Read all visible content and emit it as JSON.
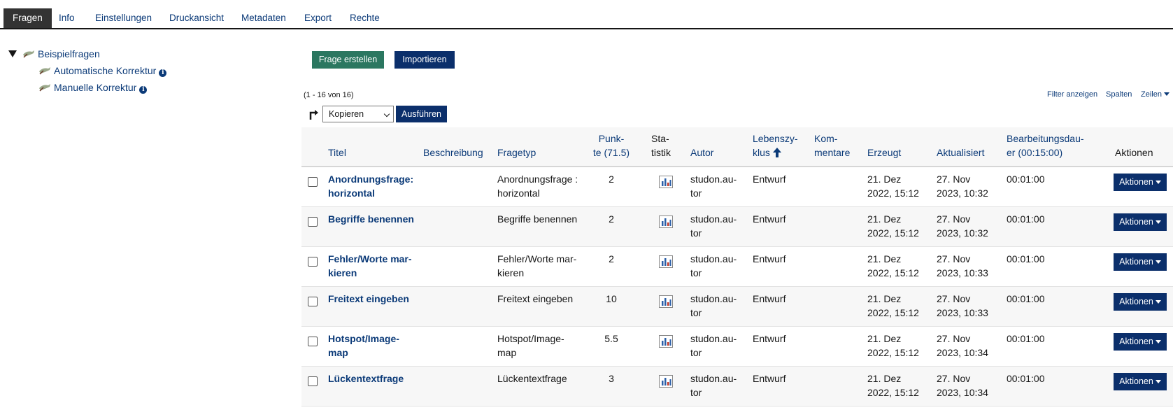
{
  "tabs": [
    "Fragen",
    "Info",
    "Einstellungen",
    "Druckansicht",
    "Metadaten",
    "Export",
    "Rechte"
  ],
  "active_tab": "Fragen",
  "tree": {
    "root": "Beispielfragen",
    "children": [
      "Automatische Korrektur",
      "Manuelle Korrektur"
    ]
  },
  "toolbar": {
    "create_label": "Frage erstellen",
    "import_label": "Importieren"
  },
  "table_info": {
    "count": "(1 - 16 von 16)",
    "filter_label": "Filter anzeigen",
    "columns_label": "Spalten",
    "rows_label": "Zeilen"
  },
  "bulk": {
    "selected_action": "Kopieren",
    "execute_label": "Ausführen"
  },
  "columns": {
    "titel": "Titel",
    "beschreibung": "Beschreibung",
    "fragetyp": "Fragetyp",
    "punkte_1": "Punk-",
    "punkte_2": "te (71.5)",
    "statistik_1": "Sta-",
    "statistik_2": "tistik",
    "autor": "Autor",
    "lebenszyklus_1": "Lebenszy-",
    "lebenszyklus_2": "klus",
    "kommentare_1": "Kom-",
    "kommentare_2": "mentare",
    "erzeugt": "Erzeugt",
    "aktualisiert": "Aktualisiert",
    "bearbeitung_1": "Bearbeitungsdau-",
    "bearbeitung_2": "er (00:15:00)",
    "aktionen": "Aktionen"
  },
  "rows": [
    {
      "title_1": "Anordnungsfrage:",
      "title_2": "horizontal",
      "type_1": "Anordnungsfrage :",
      "type_2": "horizontal",
      "points": "2",
      "author_1": "studon.au-",
      "author_2": "tor",
      "lifecycle": "Entwurf",
      "created_1": "21. Dez",
      "created_2": "2022, 15:12",
      "updated_1": "27. Nov",
      "updated_2": "2023, 10:32",
      "duration": "00:01:00",
      "action": "Aktionen"
    },
    {
      "title_1": "Begriffe benennen",
      "title_2": "",
      "type_1": "Begriffe benennen",
      "type_2": "",
      "points": "2",
      "author_1": "studon.au-",
      "author_2": "tor",
      "lifecycle": "Entwurf",
      "created_1": "21. Dez",
      "created_2": "2022, 15:12",
      "updated_1": "27. Nov",
      "updated_2": "2023, 10:32",
      "duration": "00:01:00",
      "action": "Aktionen"
    },
    {
      "title_1": "Fehler/Worte mar-",
      "title_2": "kieren",
      "type_1": "Fehler/Worte mar-",
      "type_2": "kieren",
      "points": "2",
      "author_1": "studon.au-",
      "author_2": "tor",
      "lifecycle": "Entwurf",
      "created_1": "21. Dez",
      "created_2": "2022, 15:12",
      "updated_1": "27. Nov",
      "updated_2": "2023, 10:33",
      "duration": "00:01:00",
      "action": "Aktionen"
    },
    {
      "title_1": "Freitext eingeben",
      "title_2": "",
      "type_1": "Freitext eingeben",
      "type_2": "",
      "points": "10",
      "author_1": "studon.au-",
      "author_2": "tor",
      "lifecycle": "Entwurf",
      "created_1": "21. Dez",
      "created_2": "2022, 15:12",
      "updated_1": "27. Nov",
      "updated_2": "2023, 10:33",
      "duration": "00:01:00",
      "action": "Aktionen"
    },
    {
      "title_1": "Hotspot/Image-",
      "title_2": "map",
      "type_1": "Hotspot/Image-",
      "type_2": "map",
      "points": "5.5",
      "author_1": "studon.au-",
      "author_2": "tor",
      "lifecycle": "Entwurf",
      "created_1": "21. Dez",
      "created_2": "2022, 15:12",
      "updated_1": "27. Nov",
      "updated_2": "2023, 10:34",
      "duration": "00:01:00",
      "action": "Aktionen"
    },
    {
      "title_1": "Lückentextfrage",
      "title_2": "",
      "type_1": "Lückentextfrage",
      "type_2": "",
      "points": "3",
      "author_1": "studon.au-",
      "author_2": "tor",
      "lifecycle": "Entwurf",
      "created_1": "21. Dez",
      "created_2": "2022, 15:12",
      "updated_1": "27. Nov",
      "updated_2": "2023, 10:34",
      "duration": "00:01:00",
      "action": "Aktionen"
    }
  ]
}
